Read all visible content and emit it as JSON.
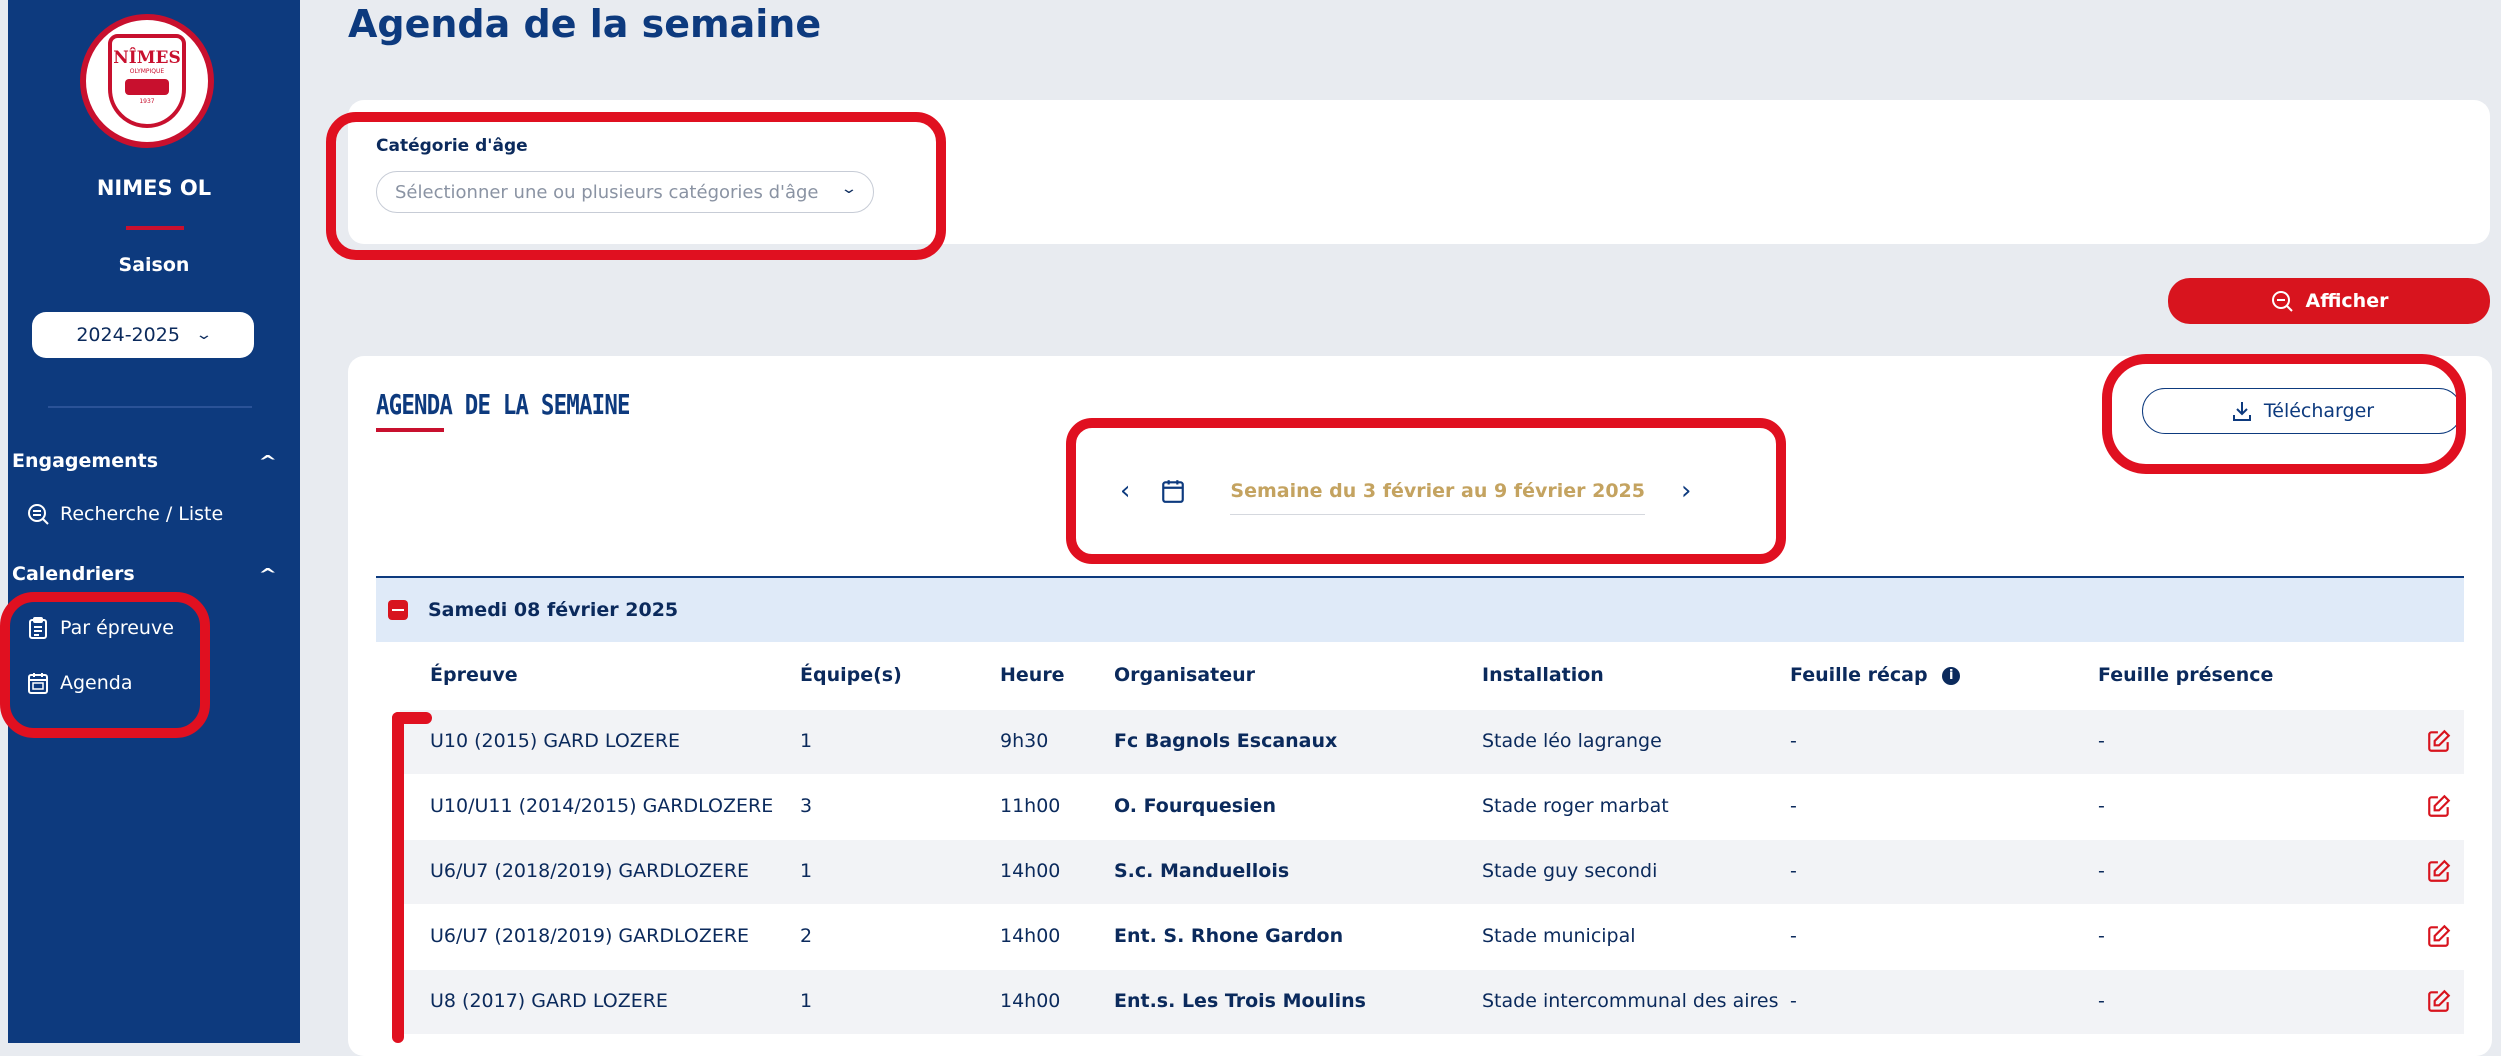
{
  "sidebar": {
    "logo_text": "NÎMES",
    "logo_subtext": "OLYMPIQUE",
    "logo_year": "1937",
    "club_name": "NIMES OL",
    "saison_label": "Saison",
    "season_value": "2024-2025",
    "sections": [
      {
        "label": "Engagements",
        "items": [
          {
            "label": "Recherche / Liste",
            "icon": "search-list-icon"
          }
        ]
      },
      {
        "label": "Calendriers",
        "items": [
          {
            "label": "Par épreuve",
            "icon": "clipboard-icon"
          },
          {
            "label": "Agenda",
            "icon": "calendar-icon"
          }
        ]
      }
    ]
  },
  "main": {
    "page_title": "Agenda de la semaine",
    "filter": {
      "label": "Catégorie d'âge",
      "placeholder": "Sélectionner une ou plusieurs catégories d'âge"
    },
    "afficher_label": "Afficher",
    "agenda": {
      "heading": "AGENDA DE LA SEMAINE",
      "download_label": "Télécharger",
      "week_label": "Semaine du 3 février au 9 février 2025",
      "day_label": "Samedi 08 février 2025",
      "columns": [
        "Épreuve",
        "Équipe(s)",
        "Heure",
        "Organisateur",
        "Installation",
        "Feuille récap",
        "Feuille présence"
      ],
      "rows": [
        {
          "epreuve": "U10 (2015) GARD LOZERE",
          "equipe": "1",
          "heure": "9h30",
          "organisateur": "Fc Bagnols Escanaux",
          "installation": "Stade léo lagrange",
          "recap": "-",
          "presence": "-"
        },
        {
          "epreuve": "U10/U11 (2014/2015) GARDLOZERE",
          "equipe": "3",
          "heure": "11h00",
          "organisateur": "O. Fourquesien",
          "installation": "Stade roger marbat",
          "recap": "-",
          "presence": "-"
        },
        {
          "epreuve": "U6/U7 (2018/2019) GARDLOZERE",
          "equipe": "1",
          "heure": "14h00",
          "organisateur": "S.c. Manduellois",
          "installation": "Stade guy secondi",
          "recap": "-",
          "presence": "-"
        },
        {
          "epreuve": "U6/U7 (2018/2019) GARDLOZERE",
          "equipe": "2",
          "heure": "14h00",
          "organisateur": "Ent. S. Rhone Gardon",
          "installation": "Stade municipal",
          "recap": "-",
          "presence": "-"
        },
        {
          "epreuve": "U8 (2017) GARD LOZERE",
          "equipe": "1",
          "heure": "14h00",
          "organisateur": "Ent.s. Les Trois Moulins",
          "installation": "Stade intercommunal des aires",
          "recap": "-",
          "presence": "-"
        }
      ]
    }
  },
  "colors": {
    "sidebar_bg": "#0d3a7e",
    "accent_red": "#d8141e",
    "week_label_gold": "#c4a360",
    "day_row_bg": "#dfeaf8"
  }
}
